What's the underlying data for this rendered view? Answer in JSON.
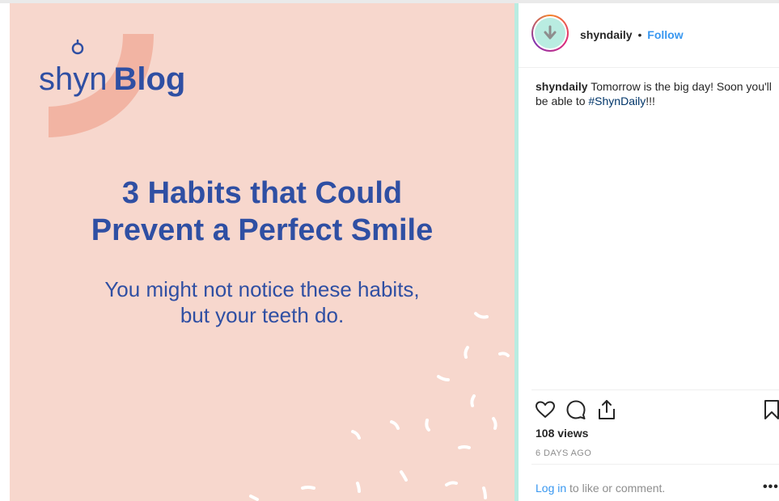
{
  "post_image": {
    "logo_shyn": "shyn",
    "logo_blog": "Blog",
    "headline_line1": "3 Habits that Could",
    "headline_line2": "Prevent a Perfect Smile",
    "subline_line1": "You might not notice these habits,",
    "subline_line2": "but your teeth do."
  },
  "header": {
    "username": "shyndaily",
    "separator": "•",
    "follow_label": "Follow"
  },
  "caption": {
    "username": "shyndaily",
    "text": " Tomorrow is the big day! Soon you'll be able to ",
    "hashtag": "#ShynDaily",
    "suffix": "!!!"
  },
  "actions": {
    "icons": [
      "heart-icon",
      "comment-icon",
      "share-icon",
      "bookmark-icon"
    ]
  },
  "stats": {
    "views": "108 views",
    "timestamp": "6 DAYS AGO"
  },
  "footer": {
    "login_label": "Log in",
    "login_suffix": " to like or comment.",
    "more_label": "•••"
  },
  "colors": {
    "image_bg": "#f7d7cd",
    "brand_blue": "#2f4fa3",
    "teal": "#b9ece1",
    "link_blue": "#3897f0",
    "hashtag_blue": "#003569"
  }
}
